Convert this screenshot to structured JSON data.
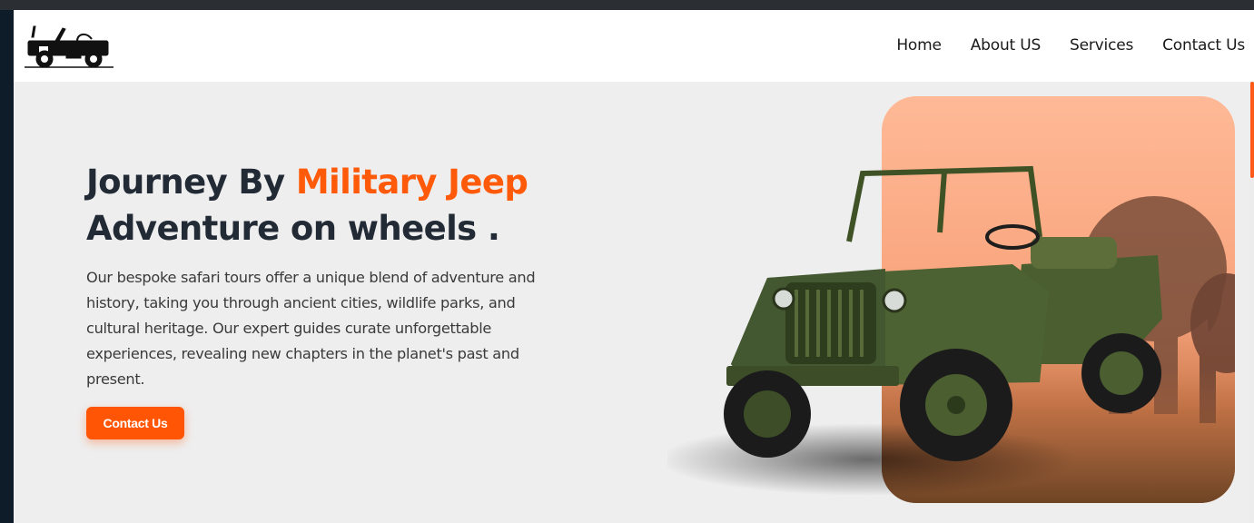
{
  "nav": {
    "items": [
      "Home",
      "About US",
      "Services",
      "Contact Us"
    ]
  },
  "hero": {
    "title_prefix": "Journey By ",
    "title_accent": "Military Jeep",
    "title_line2": "Adventure on wheels .",
    "description": "Our bespoke safari tours offer a unique blend of adventure and history, taking you through ancient cities, wildlife parks, and cultural heritage. Our expert guides curate unforgettable experiences, revealing new chapters in the planet's past and present.",
    "cta_label": "Contact Us"
  },
  "colors": {
    "accent": "#ff5a0a",
    "heading": "#222a35",
    "card_bg": "#ffb996",
    "jeep_green": "#4a5e30"
  },
  "icons": {
    "logo": "jeep-logo-icon",
    "hero_image": "military-jeep-with-elephants-image"
  }
}
